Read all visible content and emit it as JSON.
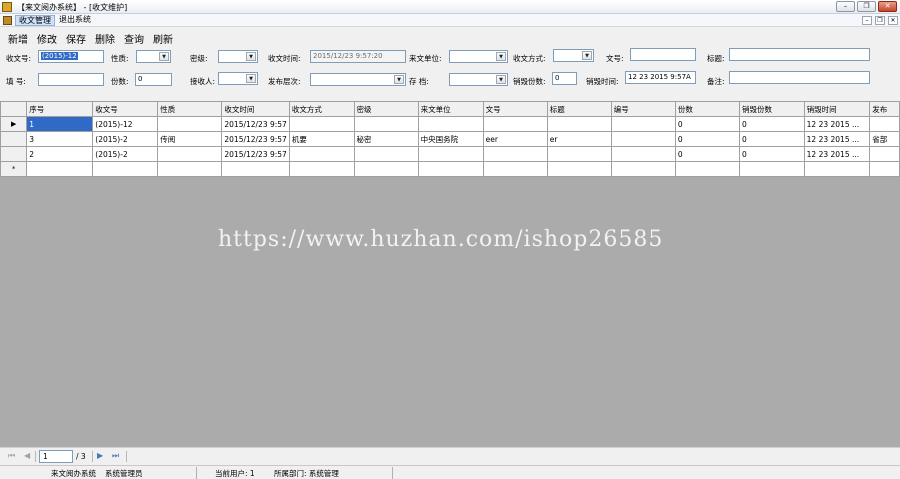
{
  "window": {
    "title": "【来文阅办系统】 - [收文维护]",
    "min": "–",
    "max": "❐",
    "close": "✕"
  },
  "menu": {
    "items": [
      "收文管理",
      "退出系统"
    ],
    "mdi_min": "–",
    "mdi_restore": "❐",
    "mdi_close": "✕"
  },
  "toolbar": {
    "add": "新增",
    "edit": "修改",
    "save": "保存",
    "delete": "删除",
    "query": "查询",
    "refresh": "刷新"
  },
  "form": {
    "receipt_no_label": "收文号:",
    "receipt_no_value": "(2015)-12",
    "nature_label": "性质:",
    "secret_label": "密级:",
    "receipt_time_label": "收文时间:",
    "receipt_time_value": "2015/12/23 9:57:20",
    "source_unit_label": "来文单位:",
    "receipt_method_label": "收文方式:",
    "doc_no_label": "文号:",
    "title_label": "标题:",
    "filler_label": "填   号:",
    "copies_label": "份数:",
    "copies_value": "0",
    "receiver_label": "接收人:",
    "publish_level_label": "发布层次:",
    "archive_label": "存   档:",
    "destroy_copies_label": "销毁份数:",
    "destroy_copies_value": "0",
    "destroy_time_label": "销毁时间:",
    "destroy_time_value": "12 23 2015  9:57A",
    "remark_label": "备注:"
  },
  "grid": {
    "columns": [
      "序号",
      "收文号",
      "性质",
      "收文时间",
      "收文方式",
      "密级",
      "来文单位",
      "文号",
      "标题",
      "编号",
      "份数",
      "销毁份数",
      "销毁时间",
      "发布"
    ],
    "rows": [
      [
        "1",
        "(2015)-12",
        "",
        "2015/12/23 9:57",
        "",
        "",
        "",
        "",
        "",
        "",
        "0",
        "0",
        "12 23 2015 ...",
        ""
      ],
      [
        "3",
        "(2015)-2",
        "传阅",
        "2015/12/23 9:57",
        "机要",
        "秘密",
        "中央国务院",
        "eer",
        "er",
        "",
        "0",
        "0",
        "12 23 2015 ...",
        "省部"
      ],
      [
        "2",
        "(2015)-2",
        "",
        "2015/12/23 9:57",
        "",
        "",
        "",
        "",
        "",
        "",
        "0",
        "0",
        "12 23 2015 ...",
        ""
      ]
    ],
    "current_marker": "▶",
    "new_marker": "*"
  },
  "watermark": "https://www.huzhan.com/ishop26585",
  "pager": {
    "first": "⏮",
    "prev": "◀",
    "current": "1",
    "total": "/ 3",
    "next": "▶",
    "last": "⏭"
  },
  "status": {
    "system": "来文阅办系统",
    "admin": "系统管理员",
    "user": "当前用户: 1",
    "dept": "所属部门: 系统管理"
  }
}
